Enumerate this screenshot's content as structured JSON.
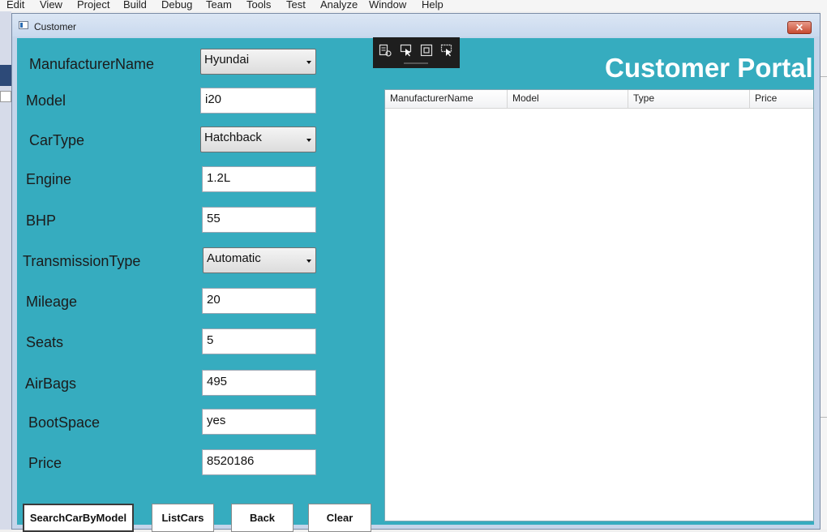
{
  "ide": {
    "menu": [
      "Edit",
      "View",
      "Project",
      "Build",
      "Debug",
      "Team",
      "Tools",
      "Test",
      "Analyze",
      "Window",
      "Help"
    ]
  },
  "window": {
    "title": "Customer",
    "close_glyph": "✕"
  },
  "header": {
    "title": "Customer Portal"
  },
  "form": {
    "manufacturer": {
      "label": "ManufacturerName",
      "value": "Hyundai"
    },
    "model": {
      "label": "Model",
      "value": "i20"
    },
    "car_type": {
      "label": "CarType",
      "value": "Hatchback"
    },
    "engine": {
      "label": "Engine",
      "value": "1.2L"
    },
    "bhp": {
      "label": "BHP",
      "value": "55"
    },
    "transmission": {
      "label": "TransmissionType",
      "value": "Automatic"
    },
    "mileage": {
      "label": "Mileage",
      "value": "20"
    },
    "seats": {
      "label": "Seats",
      "value": "5"
    },
    "airbags": {
      "label": "AirBags",
      "value": "495"
    },
    "boot_space": {
      "label": "BootSpace",
      "value": "yes"
    },
    "price": {
      "label": "Price",
      "value": "8520186"
    }
  },
  "buttons": {
    "search": "SearchCarByModel",
    "list": "ListCars",
    "back": "Back",
    "clear": "Clear"
  },
  "grid": {
    "columns": [
      "ManufacturerName",
      "Model",
      "Type",
      "Price"
    ],
    "rows": []
  },
  "debug_toolbar": {
    "icons": [
      "live-visual-tree-icon",
      "select-element-icon",
      "display-layout-adorners-icon",
      "track-focus-icon"
    ]
  }
}
